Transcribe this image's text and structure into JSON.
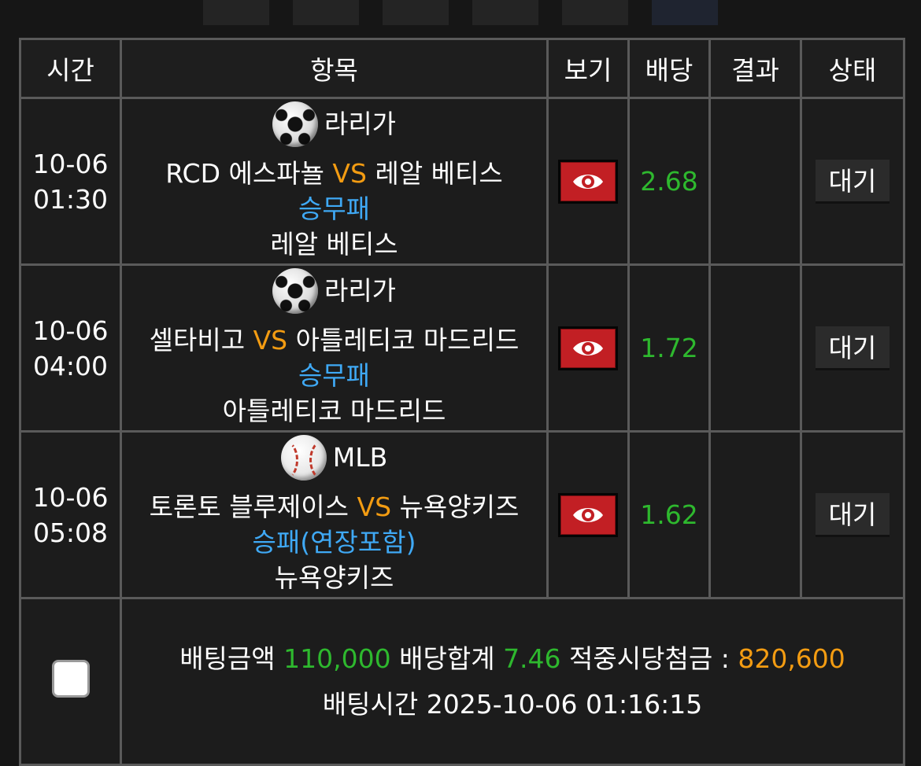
{
  "header": {
    "time": "시간",
    "item": "항목",
    "view": "보기",
    "odds": "배당",
    "result": "결과",
    "status": "상태"
  },
  "bets": [
    {
      "date": "10-06",
      "clock": "01:30",
      "sport_icon": "soccer-ball-icon",
      "league": "라리가",
      "home": "RCD 에스파뇰",
      "vs": "VS",
      "away": "레알 베티스",
      "market": "승무패",
      "pick": "레알 베티스",
      "odds": "2.68",
      "result": "",
      "status": "대기"
    },
    {
      "date": "10-06",
      "clock": "04:00",
      "sport_icon": "soccer-ball-icon",
      "league": "라리가",
      "home": "셀타비고",
      "vs": "VS",
      "away": "아틀레티코 마드리드",
      "market": "승무패",
      "pick": "아틀레티코 마드리드",
      "odds": "1.72",
      "result": "",
      "status": "대기"
    },
    {
      "date": "10-06",
      "clock": "05:08",
      "sport_icon": "baseball-icon",
      "league": "MLB",
      "home": "토론토 블루제이스",
      "vs": "VS",
      "away": "뉴욕양키즈",
      "market": "승패(연장포함)",
      "pick": "뉴욕양키즈",
      "odds": "1.62",
      "result": "",
      "status": "대기"
    }
  ],
  "summary": {
    "amount_label": "배팅금액",
    "amount": "110,000",
    "odds_total_label": "배당합계",
    "odds_total": "7.46",
    "payout_label": "적중시당첨금 :",
    "payout": "820,600",
    "time_label": "배팅시간",
    "time": "2025-10-06 01:16:15"
  },
  "colors": {
    "vs": "#f39c12",
    "market": "#3fa9f5",
    "odds": "#2eb82e",
    "eye_button": "#c21f24"
  }
}
